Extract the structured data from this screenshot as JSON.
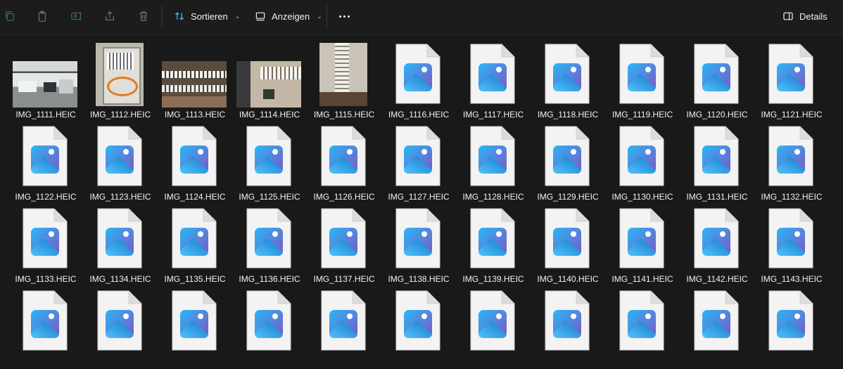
{
  "toolbar": {
    "icons": [
      "copy-icon",
      "paste-icon",
      "rename-icon",
      "share-icon",
      "delete-icon"
    ],
    "sort_label": "Sortieren",
    "view_label": "Anzeigen",
    "details_label": "Details"
  },
  "files": [
    {
      "name": "IMG_1111.HEIC",
      "thumb": "office-photo"
    },
    {
      "name": "IMG_1112.HEIC",
      "thumb": "cabinet-photo"
    },
    {
      "name": "IMG_1113.HEIC",
      "thumb": "patchpanel-photo"
    },
    {
      "name": "IMG_1114.HEIC",
      "thumb": "rack-photo"
    },
    {
      "name": "IMG_1115.HEIC",
      "thumb": "rail-photo"
    },
    {
      "name": "IMG_1116.HEIC",
      "thumb": "generic"
    },
    {
      "name": "IMG_1117.HEIC",
      "thumb": "generic"
    },
    {
      "name": "IMG_1118.HEIC",
      "thumb": "generic"
    },
    {
      "name": "IMG_1119.HEIC",
      "thumb": "generic"
    },
    {
      "name": "IMG_1120.HEIC",
      "thumb": "generic"
    },
    {
      "name": "IMG_1121.HEIC",
      "thumb": "generic"
    },
    {
      "name": "IMG_1122.HEIC",
      "thumb": "generic"
    },
    {
      "name": "IMG_1123.HEIC",
      "thumb": "generic"
    },
    {
      "name": "IMG_1124.HEIC",
      "thumb": "generic"
    },
    {
      "name": "IMG_1125.HEIC",
      "thumb": "generic"
    },
    {
      "name": "IMG_1126.HEIC",
      "thumb": "generic"
    },
    {
      "name": "IMG_1127.HEIC",
      "thumb": "generic"
    },
    {
      "name": "IMG_1128.HEIC",
      "thumb": "generic"
    },
    {
      "name": "IMG_1129.HEIC",
      "thumb": "generic"
    },
    {
      "name": "IMG_1130.HEIC",
      "thumb": "generic"
    },
    {
      "name": "IMG_1131.HEIC",
      "thumb": "generic"
    },
    {
      "name": "IMG_1132.HEIC",
      "thumb": "generic"
    },
    {
      "name": "IMG_1133.HEIC",
      "thumb": "generic"
    },
    {
      "name": "IMG_1134.HEIC",
      "thumb": "generic"
    },
    {
      "name": "IMG_1135.HEIC",
      "thumb": "generic"
    },
    {
      "name": "IMG_1136.HEIC",
      "thumb": "generic"
    },
    {
      "name": "IMG_1137.HEIC",
      "thumb": "generic"
    },
    {
      "name": "IMG_1138.HEIC",
      "thumb": "generic"
    },
    {
      "name": "IMG_1139.HEIC",
      "thumb": "generic"
    },
    {
      "name": "IMG_1140.HEIC",
      "thumb": "generic"
    },
    {
      "name": "IMG_1141.HEIC",
      "thumb": "generic"
    },
    {
      "name": "IMG_1142.HEIC",
      "thumb": "generic"
    },
    {
      "name": "IMG_1143.HEIC",
      "thumb": "generic"
    },
    {
      "name": "",
      "thumb": "generic"
    },
    {
      "name": "",
      "thumb": "generic"
    },
    {
      "name": "",
      "thumb": "generic"
    },
    {
      "name": "",
      "thumb": "generic"
    },
    {
      "name": "",
      "thumb": "generic"
    },
    {
      "name": "",
      "thumb": "generic"
    },
    {
      "name": "",
      "thumb": "generic"
    },
    {
      "name": "",
      "thumb": "generic"
    },
    {
      "name": "",
      "thumb": "generic"
    },
    {
      "name": "",
      "thumb": "generic"
    },
    {
      "name": "",
      "thumb": "generic"
    }
  ],
  "colors": {
    "background": "#191919",
    "toolbar": "#1c1c1c",
    "icon_gradient_start": "#29b6f6",
    "icon_gradient_end": "#7e57c2"
  }
}
